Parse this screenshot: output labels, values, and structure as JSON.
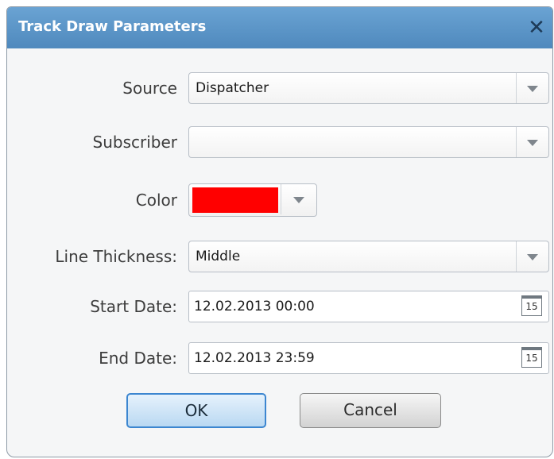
{
  "dialog": {
    "title": "Track Draw Parameters",
    "close_glyph": "✕"
  },
  "form": {
    "source": {
      "label": "Source",
      "value": "Dispatcher"
    },
    "subscriber": {
      "label": "Subscriber",
      "value": ""
    },
    "color": {
      "label": "Color",
      "value_hex": "#ff0000"
    },
    "line_thickness": {
      "label": "Line Thickness:",
      "value": "Middle"
    },
    "start_date": {
      "label": "Start Date:",
      "value": "12.02.2013 00:00",
      "calendar_day": "15"
    },
    "end_date": {
      "label": "End Date:",
      "value": "12.02.2013 23:59",
      "calendar_day": "15"
    }
  },
  "buttons": {
    "ok": "OK",
    "cancel": "Cancel"
  },
  "colors": {
    "title_bar": "#5b95c8",
    "ok_border": "#3c86d0"
  }
}
